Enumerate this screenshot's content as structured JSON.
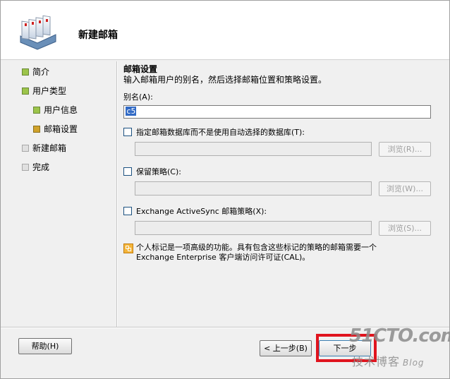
{
  "wizard": {
    "title": "新建邮箱"
  },
  "nav": {
    "items": [
      {
        "label": "简介",
        "state": "done"
      },
      {
        "label": "用户类型",
        "state": "done"
      },
      {
        "label": "用户信息",
        "state": "done"
      },
      {
        "label": "邮箱设置",
        "state": "current"
      },
      {
        "label": "新建邮箱",
        "state": "pending"
      },
      {
        "label": "完成",
        "state": "pending"
      }
    ]
  },
  "mailbox_settings": {
    "title": "邮箱设置",
    "description": "输入邮箱用户的别名，然后选择邮箱位置和策略设置。",
    "alias_label": "别名(A):",
    "alias_value": "c5",
    "database": {
      "label": "指定邮箱数据库而不是使用自动选择的数据库(T):",
      "checked": false,
      "browse_label": "浏览(R)..."
    },
    "retention": {
      "label": "保留策略(C):",
      "checked": false,
      "browse_label": "浏览(W)..."
    },
    "activesync": {
      "label": "Exchange ActiveSync 邮箱策略(X):",
      "checked": false,
      "browse_label": "浏览(S)..."
    }
  },
  "info": {
    "line1": "个人标记是一项高级的功能。具有包含这些标记的策略的邮箱需要一个",
    "line2": "Exchange Enterprise 客户端访问许可证(CAL)。",
    "icon": "tag-icon"
  },
  "footer": {
    "help_label": "帮助(H)",
    "back_label": "< 上一步(B)",
    "next_label": "下一步"
  },
  "watermark": {
    "top": "51CTO.com",
    "bottom": "技术博客",
    "blog": "Blog"
  },
  "colors": {
    "highlight": "#e0141e",
    "done_bullet": "#9cc44a",
    "current_bullet": "#d0a22a"
  }
}
